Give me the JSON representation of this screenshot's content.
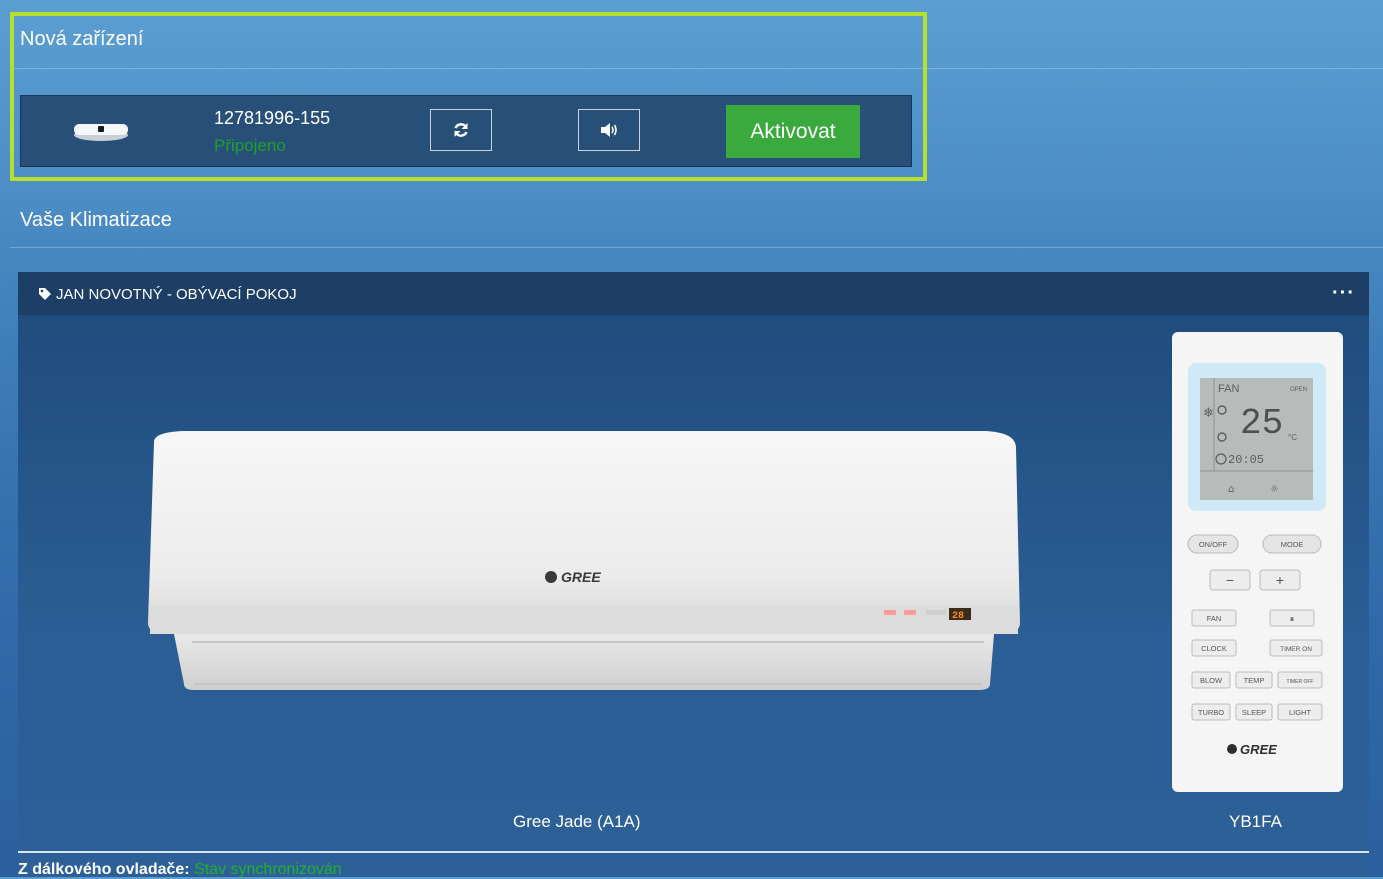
{
  "new_devices": {
    "title": "Nová zařízení",
    "device": {
      "id": "12781996-155",
      "status": "Připojeno",
      "status_color": "#1fa02a",
      "refresh_icon": "refresh-icon",
      "sound_icon": "speaker-icon",
      "activate_label": "Aktivovat",
      "activate_color": "#3aaa3e"
    },
    "highlight_color": "#b7e02c"
  },
  "ac_section": {
    "title": "Vaše Klimatizace",
    "card": {
      "title": "JAN NOVOTNÝ - OBÝVACÍ POKOJ",
      "tag_icon": "tag-icon",
      "more_label": "···",
      "unit_brand": "GREE",
      "unit_model": "Gree Jade (A1A)",
      "unit_display": "28",
      "remote_model": "YB1FA",
      "remote": {
        "lcd_fan": "FAN",
        "lcd_open": "OPEN",
        "lcd_temp": "25",
        "lcd_unit": "°C",
        "lcd_time": "20:05",
        "buttons": [
          "ON/OFF",
          "MODE",
          "−",
          "+",
          "FAN",
          "CLOCK",
          "TIMER ON",
          "BLOW",
          "TEMP",
          "TIMER OFF",
          "TURBO",
          "SLEEP",
          "LIGHT"
        ],
        "brand": "GREE"
      }
    },
    "sync": {
      "label": "Z dálkového ovladače:",
      "status": "Stav synchronizován",
      "status_color": "#22b22a"
    }
  }
}
